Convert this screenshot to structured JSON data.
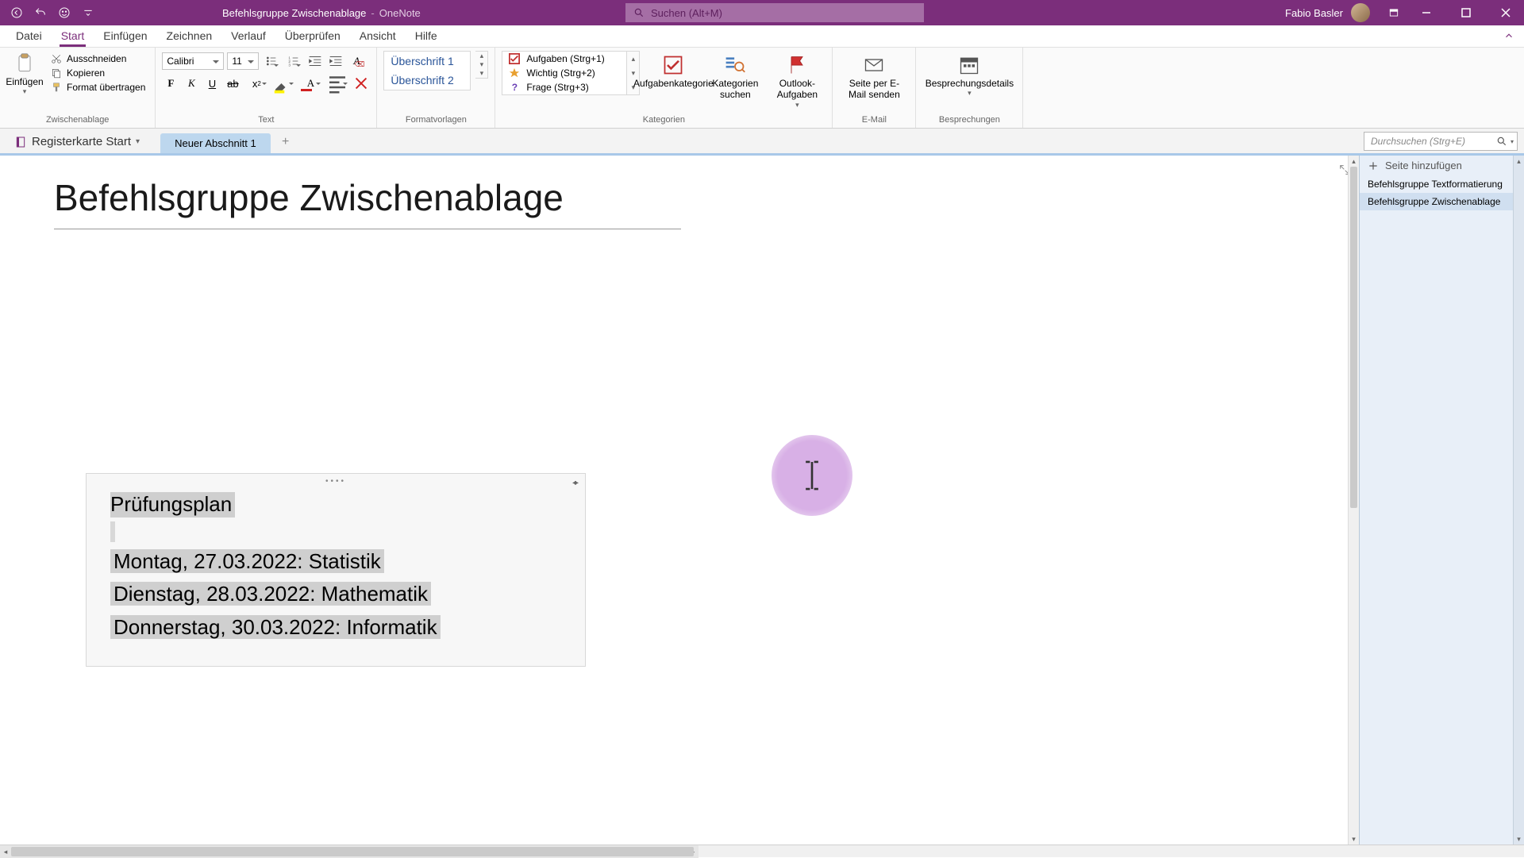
{
  "titlebar": {
    "document": "Befehlsgruppe Zwischenablage",
    "separator": "-",
    "app": "OneNote",
    "search_placeholder": "Suchen (Alt+M)",
    "user": "Fabio Basler"
  },
  "menu": {
    "tabs": [
      "Datei",
      "Start",
      "Einfügen",
      "Zeichnen",
      "Verlauf",
      "Überprüfen",
      "Ansicht",
      "Hilfe"
    ],
    "active_index": 1
  },
  "ribbon": {
    "clipboard": {
      "paste": "Einfügen",
      "cut": "Ausschneiden",
      "copy": "Kopieren",
      "format_painter": "Format übertragen",
      "group_label": "Zwischenablage"
    },
    "text": {
      "font_name": "Calibri",
      "font_size": "11",
      "group_label": "Text"
    },
    "styles": {
      "items": [
        "Überschrift 1",
        "Überschrift 2"
      ],
      "group_label": "Formatvorlagen"
    },
    "tags": {
      "items": [
        {
          "icon": "checkbox",
          "label": "Aufgaben (Strg+1)"
        },
        {
          "icon": "star",
          "label": "Wichtig (Strg+2)"
        },
        {
          "icon": "question",
          "label": "Frage (Strg+3)"
        }
      ],
      "task_category": "Aufgabenkategorie",
      "find_tags": "Kategorien suchen",
      "outlook_tasks": "Outlook-Aufgaben",
      "group_label": "Kategorien"
    },
    "email": {
      "send_page": "Seite per E-Mail senden",
      "group_label": "E-Mail"
    },
    "meetings": {
      "details": "Besprechungsdetails",
      "group_label": "Besprechungen"
    }
  },
  "nav": {
    "notebook": "Registerkarte Start",
    "section": "Neuer Abschnitt 1",
    "page_search_placeholder": "Durchsuchen (Strg+E)"
  },
  "pages": {
    "add": "Seite hinzufügen",
    "items": [
      "Befehlsgruppe Textformatierung",
      "Befehlsgruppe Zwischenablage"
    ],
    "active_index": 1
  },
  "page": {
    "title": "Befehlsgruppe Zwischenablage",
    "note": {
      "heading": "Prüfungsplan",
      "lines": [
        "Montag, 27.03.2022: Statistik",
        "Dienstag, 28.03.2022: Mathematik",
        "Donnerstag, 30.03.2022: Informatik"
      ]
    }
  }
}
